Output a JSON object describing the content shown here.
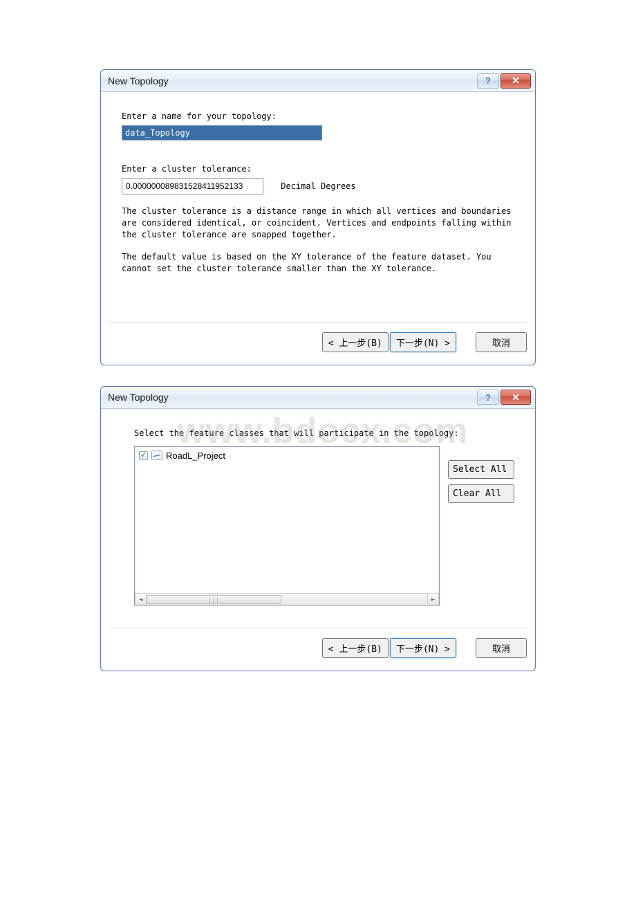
{
  "dialog1": {
    "title": "New Topology",
    "help_glyph": "?",
    "close_glyph": "✕",
    "name_label": "Enter a name for your topology:",
    "name_value": "data_Topology",
    "tolerance_label": "Enter a cluster tolerance:",
    "tolerance_value": "0.000000089831528411952133",
    "tolerance_unit": "Decimal Degrees",
    "help_text1": "The cluster tolerance is a distance range in which all vertices and boundaries are considered identical, or coincident. Vertices and endpoints falling within the cluster tolerance are snapped together.",
    "help_text2": "The default value is based on the XY tolerance of the feature dataset. You cannot set the cluster tolerance smaller than the XY tolerance.",
    "back_label": "< 上一步(B)",
    "next_label": "下一步(N) >",
    "cancel_label": "取消"
  },
  "dialog2": {
    "title": "New Topology",
    "help_glyph": "?",
    "close_glyph": "✕",
    "instruction": "Select the feature classes that will participate in the topology:",
    "feature_item": "RoadL_Project",
    "check_glyph": "✓",
    "select_all_label": "Select All",
    "clear_all_label": "Clear All",
    "scroll_left": "◄",
    "scroll_right": "►",
    "scroll_grip": "|||",
    "back_label": "< 上一步(B)",
    "next_label": "下一步(N) >",
    "cancel_label": "取消"
  },
  "watermark": "www.bdocx.com"
}
